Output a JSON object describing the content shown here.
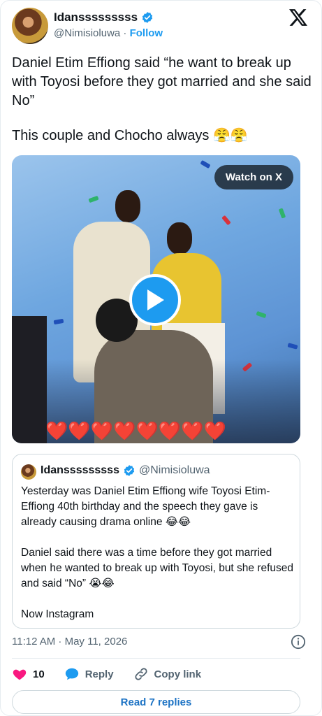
{
  "author": {
    "display_name": "Idansssssssss",
    "handle": "@Nimisioluwa",
    "separator": "·",
    "follow_label": "Follow"
  },
  "tweet": {
    "text_line1": "Daniel Etim Effiong said “he want to break up with Toyosi before they got married and she said No”",
    "text_line2": "This couple and Chocho always 😤😤"
  },
  "video": {
    "watch_label": "Watch on X",
    "hearts": "❤️❤️❤️❤️❤️❤️❤️❤️"
  },
  "quoted": {
    "display_name": "Idansssssssss",
    "handle": "@Nimisioluwa",
    "para1": "Yesterday was Daniel Etim Effiong wife Toyosi Etim-Effiong 40th birthday and the speech they gave is already causing drama online 😂😂",
    "para2": "Daniel said there was a time before they got married when he wanted to break up with Toyosi, but she refused and said “No” 😭😂",
    "para3": "Now Instagram"
  },
  "meta": {
    "timestamp": "11:12 AM · May 11, 2026"
  },
  "actions": {
    "like_count": "10",
    "reply_label": "Reply",
    "copy_label": "Copy link",
    "read_replies_label": "Read 7 replies"
  },
  "colors": {
    "accent": "#1d9bf0",
    "like": "#f91880",
    "text": "#0f1419",
    "muted": "#536471"
  }
}
